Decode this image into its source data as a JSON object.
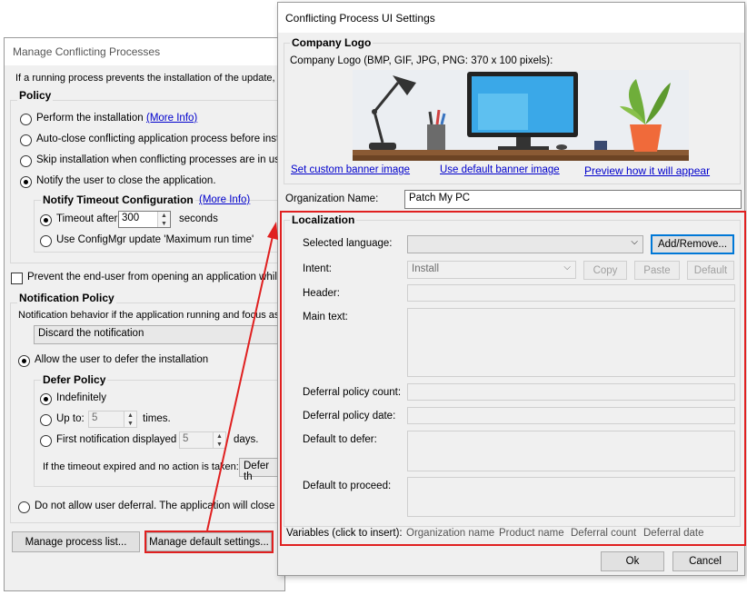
{
  "main": {
    "title": "Manage Conflicting Processes",
    "description": "If a running process prevents the installation of the update, ap",
    "policy": {
      "title": "Policy",
      "perform": "Perform the installation",
      "more_info": "(More Info)",
      "autoclose": "Auto-close conflicting application process before installa",
      "skip": "Skip installation when conflicting processes are in use",
      "notify": "Notify the user to close the application.",
      "timeout_title": "Notify Timeout Configuration",
      "timeout_more_info": "(More Info)",
      "timeout_after": "Timeout after",
      "timeout_value": "300",
      "seconds": "seconds",
      "use_configmgr": "Use ConfigMgr update 'Maximum run time'"
    },
    "prevent": "Prevent the end-user from opening an application while the",
    "notification": {
      "title": "Notification Policy",
      "behavior": "Notification behavior if the application running and focus assi",
      "behavior_value": "Discard the notification",
      "allow_defer": "Allow the user to defer the installation",
      "defer_title": "Defer Policy",
      "indefinitely": "Indefinitely",
      "up_to": "Up to:",
      "up_to_value": "5",
      "times": "times.",
      "first_notification": "First notification displayed +",
      "first_value": "5",
      "days": "days.",
      "timeout_expired": "If the timeout expired and no action is taken:",
      "timeout_expired_value": "Defer th",
      "no_defer": "Do not allow user deferral. The application will close and"
    },
    "buttons": {
      "manage_process_list": "Manage process list...",
      "manage_default_settings": "Manage default settings..."
    }
  },
  "dialog": {
    "title": "Conflicting Process UI Settings",
    "company_logo": {
      "title": "Company Logo",
      "caption": "Company Logo (BMP, GIF, JPG, PNG: 370 x 100 pixels):",
      "set_custom": "Set custom banner image",
      "use_default": "Use default banner image",
      "preview": "Preview how it will appear"
    },
    "organization_name_label": "Organization Name:",
    "organization_name_value": "Patch My PC",
    "localization": {
      "title": "Localization",
      "selected_language": "Selected language:",
      "add_remove": "Add/Remove...",
      "intent": "Intent:",
      "intent_value": "Install",
      "copy": "Copy",
      "paste": "Paste",
      "default": "Default",
      "header": "Header:",
      "main_text": "Main text:",
      "deferral_count": "Deferral policy count:",
      "deferral_date": "Deferral policy date:",
      "default_defer": "Default to defer:",
      "default_proceed": "Default to proceed:"
    },
    "variables": {
      "label": "Variables (click to insert):",
      "items": [
        "Organization name",
        "Product name",
        "Deferral count",
        "Deferral date"
      ]
    },
    "ok": "Ok",
    "cancel": "Cancel"
  },
  "colors": {
    "accent": "#e02020",
    "link": "#0000cc",
    "monitor_screen": "#3aa8e8"
  }
}
